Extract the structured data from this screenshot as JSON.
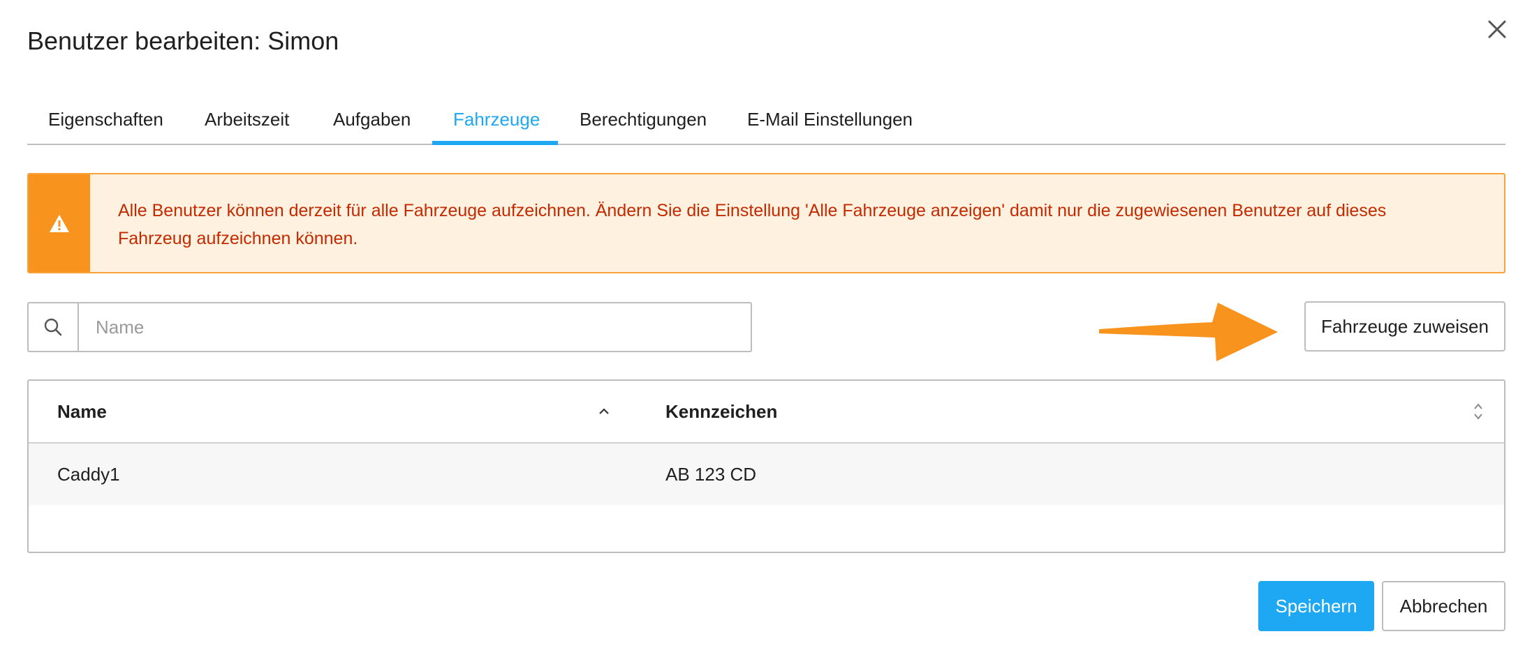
{
  "dialog": {
    "title": "Benutzer bearbeiten: Simon",
    "close_icon": "close-icon"
  },
  "tabs": [
    {
      "label": "Eigenschaften",
      "active": false
    },
    {
      "label": "Arbeitszeit",
      "active": false
    },
    {
      "label": "Aufgaben",
      "active": false
    },
    {
      "label": "Fahrzeuge",
      "active": true
    },
    {
      "label": "Berechtigungen",
      "active": false
    },
    {
      "label": "E-Mail Einstellungen",
      "active": false
    }
  ],
  "alert": {
    "icon": "warning-icon",
    "line1": "Alle Benutzer können derzeit für alle Fahrzeuge aufzeichnen. Ändern Sie die Einstellung 'Alle Fahrzeuge anzeigen' damit nur die zugewiesenen Benutzer auf dieses",
    "line2": "Fahrzeug aufzeichnen können."
  },
  "search": {
    "icon": "search-icon",
    "placeholder": "Name",
    "value": ""
  },
  "assign_button": {
    "label": "Fahrzeuge zuweisen"
  },
  "table": {
    "columns": [
      {
        "label": "Name",
        "sort": "ascending"
      },
      {
        "label": "Kennzeichen",
        "sort": "none"
      }
    ],
    "rows": [
      {
        "name": "Caddy1",
        "plate": "AB 123 CD"
      }
    ]
  },
  "footer": {
    "save_label": "Speichern",
    "cancel_label": "Abbrechen"
  },
  "colors": {
    "accent": "#1ea7f2",
    "warning": "#f8941d",
    "warning_bg": "#fff1e0",
    "warning_text": "#c42a00",
    "annotation_arrow": "#f8941d"
  }
}
